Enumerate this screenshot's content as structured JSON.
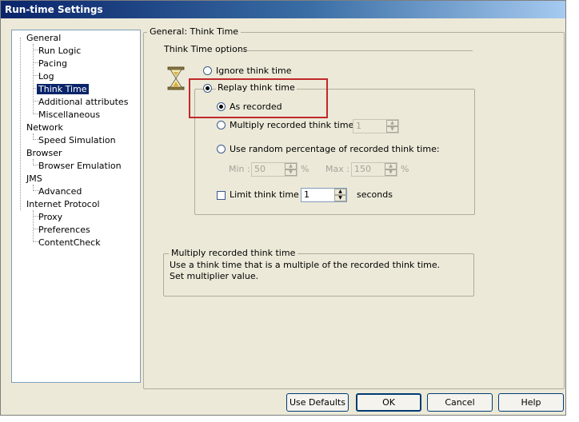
{
  "window": {
    "title": "Run-time Settings"
  },
  "tree": {
    "items": [
      {
        "label": "General",
        "level": 0
      },
      {
        "label": "Run Logic",
        "level": 1
      },
      {
        "label": "Pacing",
        "level": 1
      },
      {
        "label": "Log",
        "level": 1
      },
      {
        "label": "Think Time",
        "level": 1,
        "selected": true
      },
      {
        "label": "Additional attributes",
        "level": 1
      },
      {
        "label": "Miscellaneous",
        "level": 1
      },
      {
        "label": "Network",
        "level": 0
      },
      {
        "label": "Speed Simulation",
        "level": 1
      },
      {
        "label": "Browser",
        "level": 0
      },
      {
        "label": "Browser Emulation",
        "level": 1
      },
      {
        "label": "JMS",
        "level": 0
      },
      {
        "label": "Advanced",
        "level": 1
      },
      {
        "label": "Internet Protocol",
        "level": 0
      },
      {
        "label": "Proxy",
        "level": 1
      },
      {
        "label": "Preferences",
        "level": 1
      },
      {
        "label": "ContentCheck",
        "level": 1
      }
    ]
  },
  "panel": {
    "header": "General: Think Time",
    "options_title": "Think Time options",
    "ignore_label": "Ignore think time",
    "replay_label": "Replay think time",
    "as_recorded_label": "As recorded",
    "multiply_label": "Multiply recorded think time by:",
    "multiply_value": "1",
    "random_label": "Use random percentage of recorded think time:",
    "min_label": "Min :",
    "min_value": "50",
    "max_label": "Max :",
    "max_value": "150",
    "percent": "%",
    "limit_label": "Limit think time to:",
    "limit_value": "1",
    "seconds": "seconds"
  },
  "description": {
    "title": "Multiply recorded think time",
    "line1": "Use a think time that is a multiple of the recorded think time.",
    "line2": "Set multiplier value."
  },
  "buttons": {
    "use_defaults": "Use Defaults",
    "ok": "OK",
    "cancel": "Cancel",
    "help": "Help"
  },
  "selected_option": "as_recorded",
  "accent_colors": {
    "selection": "#0a246a",
    "highlight_box": "#c0282a"
  }
}
